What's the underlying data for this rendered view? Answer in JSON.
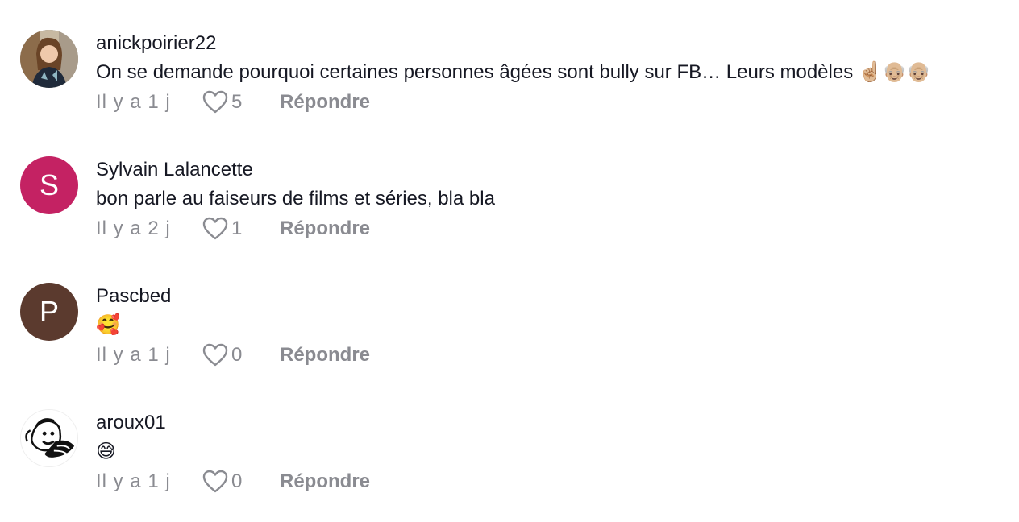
{
  "colors": {
    "text_primary": "#161823",
    "text_secondary": "#8a8b91",
    "avatar_s": "#c42263",
    "avatar_p": "#5b3a2e"
  },
  "comments": [
    {
      "username": "anickpoirier22",
      "avatar": "photo-avatar",
      "text": "On se demande pourquoi certaines personnes âgées sont bully sur FB… Leurs modèles ",
      "emojis": [
        "☝🏼",
        "👴🏼",
        "👴🏼"
      ],
      "time": "Il y a 1 j",
      "likes": "5",
      "reply": "Répondre"
    },
    {
      "username": "Sylvain Lalancette",
      "avatar_letter": "S",
      "text": "bon parle au faiseurs de films et séries, bla bla",
      "time": "Il y a 2 j",
      "likes": "1",
      "reply": "Répondre"
    },
    {
      "username": "Pascbed",
      "avatar_letter": "P",
      "text": "🥰",
      "time": "Il y a 1 j",
      "likes": "0",
      "reply": "Répondre"
    },
    {
      "username": "aroux01",
      "avatar": "cartoon-avatar",
      "text": "😅",
      "time": "Il y a 1 j",
      "likes": "0",
      "reply": "Répondre"
    }
  ]
}
